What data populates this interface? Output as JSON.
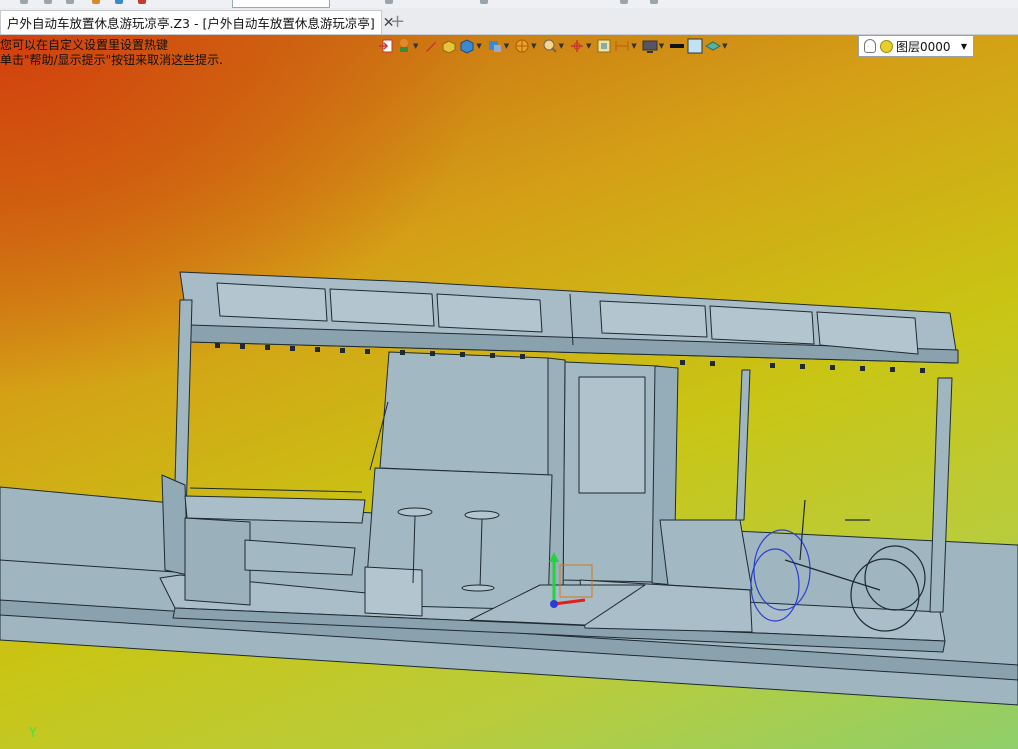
{
  "tab": {
    "title": "户外自动车放置休息游玩凉亭.Z3 - [户外自动车放置休息游玩凉亭]",
    "close_glyph": "✕",
    "add_glyph": "+"
  },
  "hint": {
    "line1": "您可以在自定义设置里设置热键",
    "line2": "单击\"帮助/显示提示\"按钮来取消这些提示."
  },
  "toolbar": {
    "icons": [
      "insert-icon",
      "pin-icon",
      "pencil-icon",
      "box-icon",
      "cube-icon",
      "view-cube-icon",
      "render-sphere-icon",
      "zoom-icon",
      "axis-icon",
      "frame-icon",
      "dimension-icon",
      "monitor-icon",
      "line-color-icon",
      "fill-color-icon",
      "layers-icon"
    ]
  },
  "layer": {
    "name": "图层0000"
  },
  "axis": {
    "y_label": "Y"
  },
  "colors": {
    "model_fill": "#9fb5c0",
    "model_stroke": "#1e2a30",
    "wheel": "#2a3fd0",
    "axis_x": "#e0201e",
    "axis_y": "#22d43a",
    "axis_z": "#2a3bd8"
  }
}
